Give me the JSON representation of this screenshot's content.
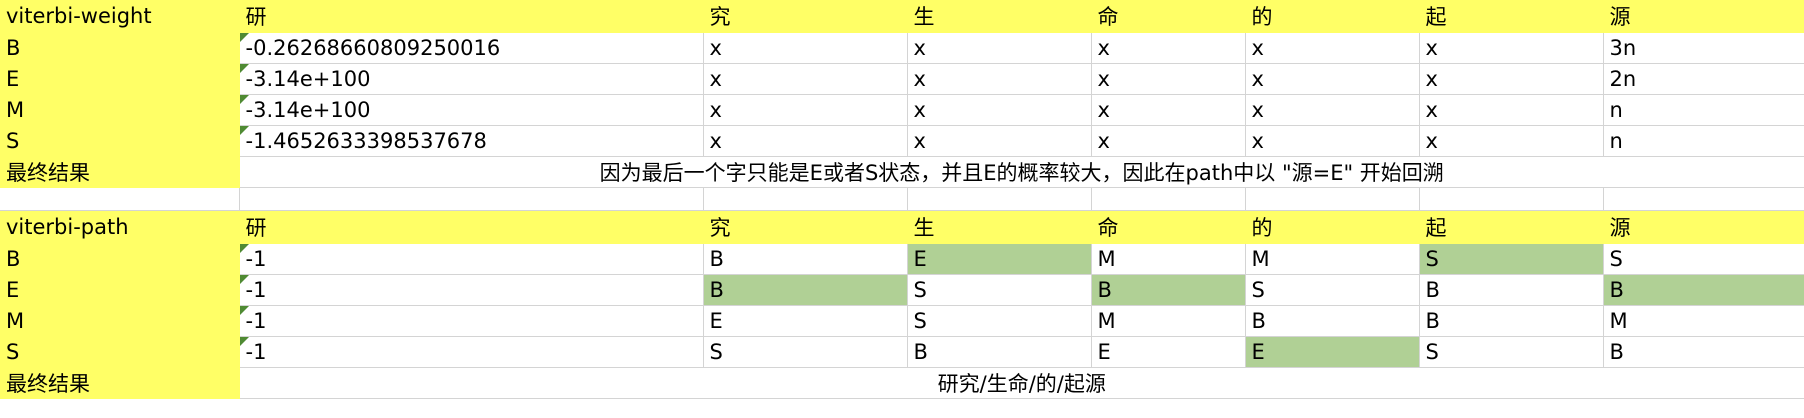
{
  "table1": {
    "header": [
      "viterbi-weight",
      "研",
      "究",
      "生",
      "命",
      "的",
      "起",
      "源"
    ],
    "rows": [
      [
        "B",
        "-0.26268660809250016",
        "x",
        "x",
        "x",
        "x",
        "x",
        "3n"
      ],
      [
        "E",
        "-3.14e+100",
        "x",
        "x",
        "x",
        "x",
        "x",
        "2n"
      ],
      [
        "M",
        "-3.14e+100",
        "x",
        "x",
        "x",
        "x",
        "x",
        "n"
      ],
      [
        "S",
        "-1.4652633398537678",
        "x",
        "x",
        "x",
        "x",
        "x",
        "n"
      ]
    ],
    "result_label": "最终结果",
    "result_text": "因为最后一个字只能是E或者S状态，并且E的概率较大，因此在path中以 \"源=E\" 开始回溯"
  },
  "table2": {
    "header": [
      "viterbi-path",
      "研",
      "究",
      "生",
      "命",
      "的",
      "起",
      "源"
    ],
    "rows": [
      [
        "B",
        "-1",
        "B",
        "E",
        "M",
        "M",
        "S",
        "S"
      ],
      [
        "E",
        "-1",
        "B",
        "S",
        "B",
        "S",
        "B",
        "B"
      ],
      [
        "M",
        "-1",
        "E",
        "S",
        "M",
        "B",
        "B",
        "M"
      ],
      [
        "S",
        "-1",
        "S",
        "B",
        "E",
        "E",
        "S",
        "B"
      ]
    ],
    "result_label": "最终结果",
    "result_text": "研究/生命/的/起源"
  },
  "colors": {
    "header_fill": "#ffff66",
    "path_highlight": "#b0d095",
    "number_as_text_marker": "#4f8a33"
  }
}
